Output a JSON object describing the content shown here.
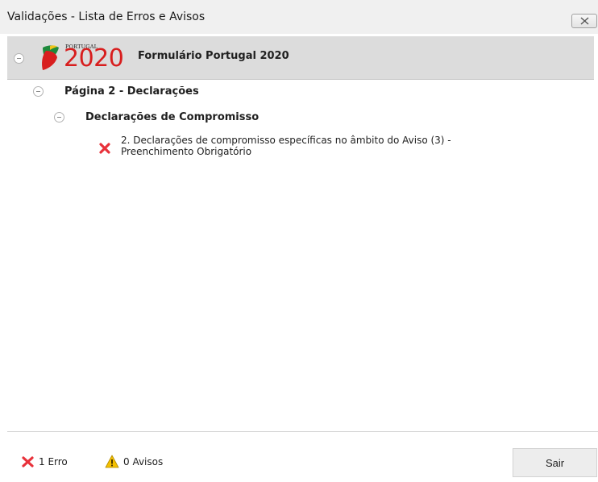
{
  "window": {
    "title": "Validações - Lista de Erros e Avisos",
    "close_icon": "close-icon"
  },
  "tree": {
    "root": {
      "logo_small_text": "PORTUGAL",
      "logo_year": "2020",
      "label": "Formulário Portugal 2020",
      "expanded": true
    },
    "page": {
      "label": "Página 2 - Declarações",
      "expanded": true
    },
    "section": {
      "label": "Declarações de Compromisso",
      "expanded": true
    },
    "errors": [
      {
        "line1": "2. Declarações de compromisso específicas no âmbito do Aviso (3) -",
        "line2": "Preenchimento Obrigatório",
        "icon": "error-x-icon"
      }
    ]
  },
  "footer": {
    "error_count_label": "1 Erro",
    "warning_count_label": "0 Avisos",
    "exit_label": "Sair"
  },
  "colors": {
    "error_red": "#e8313a",
    "warning_yellow": "#f5c000",
    "logo_red": "#d81e1e",
    "logo_green": "#1e8a3c",
    "root_row_bg": "#dcdcdc"
  }
}
